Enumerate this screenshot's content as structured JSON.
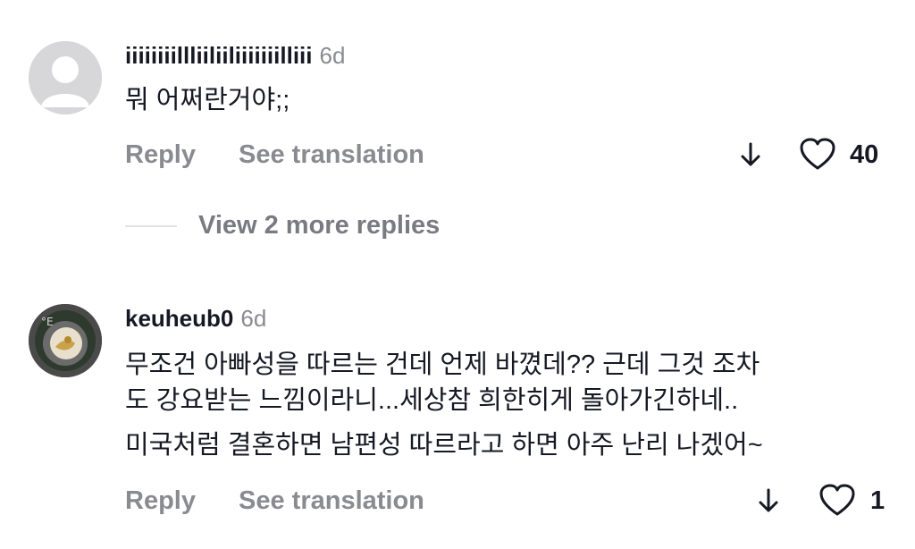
{
  "comments": [
    {
      "username": "iiiiiiiillliiliiliiiiiiilliii",
      "time": "6d",
      "text_lines": [
        "뭐 어쩌란거야;;"
      ],
      "reply_label": "Reply",
      "translate_label": "See translation",
      "likes": "40",
      "avatar": "default-avatar"
    },
    {
      "username": "keuheub0",
      "time": "6d",
      "text_lines": [
        "무조건 아빠성을 따르는 건데 언제 바꼈데?? 근데 그것 조차",
        "도 강요받는 느낌이라니...세상참 희한히게 돌아가긴하네..",
        "미국처럼 결혼하면 남편성 따르라고 하면 아주 난리 나겠어~"
      ],
      "reply_label": "Reply",
      "translate_label": "See translation",
      "likes": "1",
      "avatar": "photo-avatar"
    }
  ],
  "view_replies_label": "View 2 more replies"
}
